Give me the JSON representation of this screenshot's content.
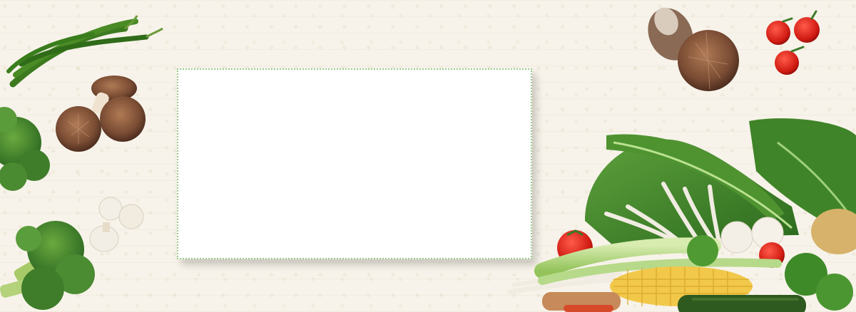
{
  "colors": {
    "background": "#f7f3ea",
    "frame_border": "#9cc98d",
    "frame_fill": "#ffffff"
  },
  "elements": [
    "chili-pepper-icon",
    "shiitake-mushroom-icon",
    "broccoli-icon",
    "button-mushroom-icon",
    "cherry-tomato-icon",
    "leafy-greens-icon",
    "corn-icon",
    "enoki-mushroom-icon",
    "potato-icon",
    "cucumber-icon"
  ]
}
